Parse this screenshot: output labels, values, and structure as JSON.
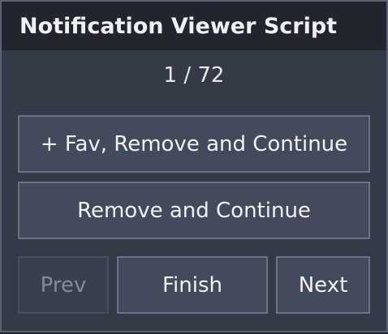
{
  "window": {
    "title": "Notification Viewer Script"
  },
  "counter": {
    "text": "1 / 72",
    "current": 1,
    "total": 72
  },
  "buttons": {
    "fav_remove_continue": "+ Fav, Remove and Continue",
    "remove_continue": "Remove and Continue",
    "prev": "Prev",
    "finish": "Finish",
    "next": "Next"
  },
  "states": {
    "prev_disabled": true
  },
  "colors": {
    "titlebar": "#22252d",
    "body": "#353b46",
    "button": "#434a5b",
    "button_border": "#6c7186"
  }
}
